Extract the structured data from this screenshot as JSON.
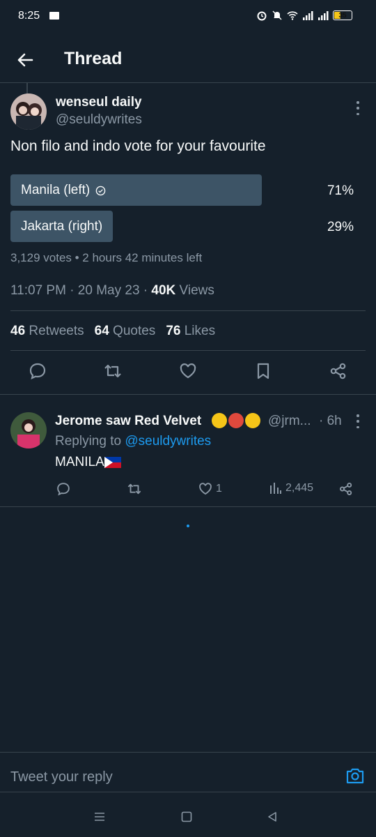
{
  "status_bar": {
    "time": "8:25",
    "battery": "35"
  },
  "header": {
    "title": "Thread"
  },
  "tweet": {
    "author_name": "wenseul daily",
    "author_handle": "@seuldywrites",
    "text": "Non filo and indo vote for your favourite",
    "poll": {
      "options": [
        {
          "label": "Manila (left)",
          "percent_text": "71%",
          "percent": 71,
          "selected": true
        },
        {
          "label": "Jakarta (right)",
          "percent_text": "29%",
          "percent": 29,
          "selected": false
        }
      ],
      "summary": "3,129 votes • 2 hours 42 minutes left"
    },
    "timestamp": "11:07 PM · 20 May 23 · ",
    "views_count": "40K",
    "views_label": " Views",
    "stats": {
      "retweets_count": "46",
      "retweets_label": "Retweets",
      "quotes_count": "64",
      "quotes_label": "Quotes",
      "likes_count": "76",
      "likes_label": "Likes"
    }
  },
  "reply": {
    "author_name": "Jerome saw Red Velvet",
    "author_handle": "@jrm...",
    "age": "· 6h",
    "replying_prefix": "Replying to ",
    "replying_to": "@seuldywrites",
    "text": "MANILA",
    "likes": "1",
    "views": "2,445"
  },
  "composer": {
    "placeholder": "Tweet your reply"
  },
  "colors": {
    "background": "#15202b",
    "accent": "#1d9bf0",
    "poll_bar": "#3d5466",
    "muted": "#8b98a5"
  }
}
